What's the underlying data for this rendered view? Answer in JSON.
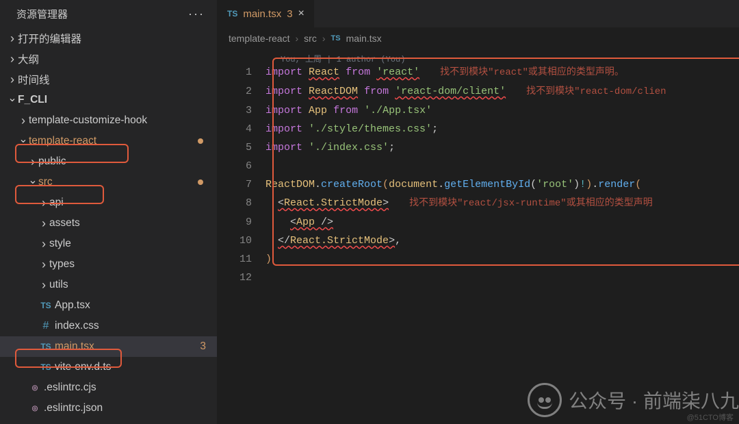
{
  "sidebar": {
    "title": "资源管理器",
    "sections": {
      "open_editors": "打开的编辑器",
      "outline": "大纲",
      "timeline": "时间线",
      "project": "F_CLI"
    },
    "tree": {
      "tch": "template-customize-hook",
      "tr": "template-react",
      "public": "public",
      "src": "src",
      "api": "api",
      "assets": "assets",
      "style": "style",
      "types": "types",
      "utils": "utils",
      "app": "App.tsx",
      "indexcss": "index.css",
      "main": "main.tsx",
      "main_badge": "3",
      "viteenv": "vite-env.d.ts",
      "eslintrc": ".eslintrc.cjs",
      "eslintrcjson": ".eslintrc.json"
    }
  },
  "tab": {
    "icon": "TS",
    "label": "main.tsx",
    "count": "3"
  },
  "breadcrumb": {
    "p1": "template-react",
    "p2": "src",
    "icon": "TS",
    "p3": "main.tsx"
  },
  "codelens": "You, 上周 | 1 author (You)",
  "code": {
    "l1": {
      "kw": "import",
      "id": "React",
      "from": "from",
      "str": "'react'",
      "err": "找不到模块\"react\"或其相应的类型声明。"
    },
    "l2": {
      "kw": "import",
      "id": "ReactDOM",
      "from": "from",
      "str": "'react-dom/client'",
      "err": "找不到模块\"react-dom/clien"
    },
    "l3": {
      "kw": "import",
      "id": "App",
      "from": "from",
      "str": "'./App.tsx'"
    },
    "l4": {
      "kw": "import",
      "str": "'./style/themes.css'",
      "semi": ";"
    },
    "l5": {
      "kw": "import",
      "str": "'./index.css'",
      "semi": ";"
    },
    "l7a": "ReactDOM",
    "l7b": "createRoot",
    "l7c": "document",
    "l7d": "getElementById",
    "l7e": "'root'",
    "l7f": "render",
    "l8": {
      "open": "<",
      "tag": "React.StrictMode",
      "close": ">",
      "err": "找不到模块\"react/jsx-runtime\"或其相应的类型声明"
    },
    "l9": {
      "open": "<",
      "tag": "App",
      "close": " />"
    },
    "l10": {
      "open": "</",
      "tag": "React.StrictMode",
      "close": ">",
      "comma": ","
    },
    "l11": ")"
  },
  "lines": [
    "1",
    "2",
    "3",
    "4",
    "5",
    "6",
    "7",
    "8",
    "9",
    "10",
    "11",
    "12"
  ],
  "watermark": "公众号 · 前端柒八九",
  "watermark_small": "@51CTO博客"
}
